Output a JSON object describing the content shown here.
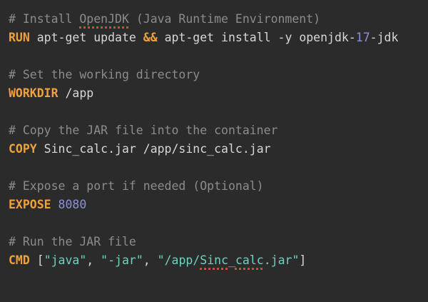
{
  "editor": {
    "background": "#2b2b2b",
    "syntax_colors": {
      "comment": "#8c8c8c",
      "keyword": "#f1a13a",
      "number": "#8e90d8",
      "string": "#6ed2bd",
      "text": "#d7d7d7",
      "spellcheck": "#e0443e"
    },
    "lines": {
      "l1": {
        "comment_prefix": "# Install ",
        "comment_misspelled": "OpenJDK",
        "comment_suffix": " (Java Runtime Environment)"
      },
      "l2": {
        "keyword": "RUN",
        "text1": " apt-get update ",
        "op": "&&",
        "text2": " apt-get install -y openjdk-",
        "number": "17",
        "text3": "-jdk"
      },
      "l4": {
        "comment": "# Set the working directory"
      },
      "l5": {
        "keyword": "WORKDIR",
        "text": " /app"
      },
      "l7": {
        "comment": "# Copy the JAR file into the container"
      },
      "l8": {
        "keyword": "COPY",
        "text": " Sinc_calc.jar /app/sinc_calc.jar"
      },
      "l10": {
        "comment": "# Expose a port if needed (Optional)"
      },
      "l11": {
        "keyword": "EXPOSE",
        "space": " ",
        "number": "8080"
      },
      "l13": {
        "comment": "# Run the JAR file"
      },
      "l14": {
        "keyword": "CMD",
        "open": " [",
        "str1": "\"java\"",
        "sep1": ", ",
        "str2": "\"-jar\"",
        "sep2": ", ",
        "str3_prefix": "\"/app/",
        "str3_misspelled_a": "Sinc",
        "str3_underscore": "_",
        "str3_misspelled_b": "calc",
        "str3_suffix": ".jar\"",
        "close": "]"
      }
    }
  }
}
